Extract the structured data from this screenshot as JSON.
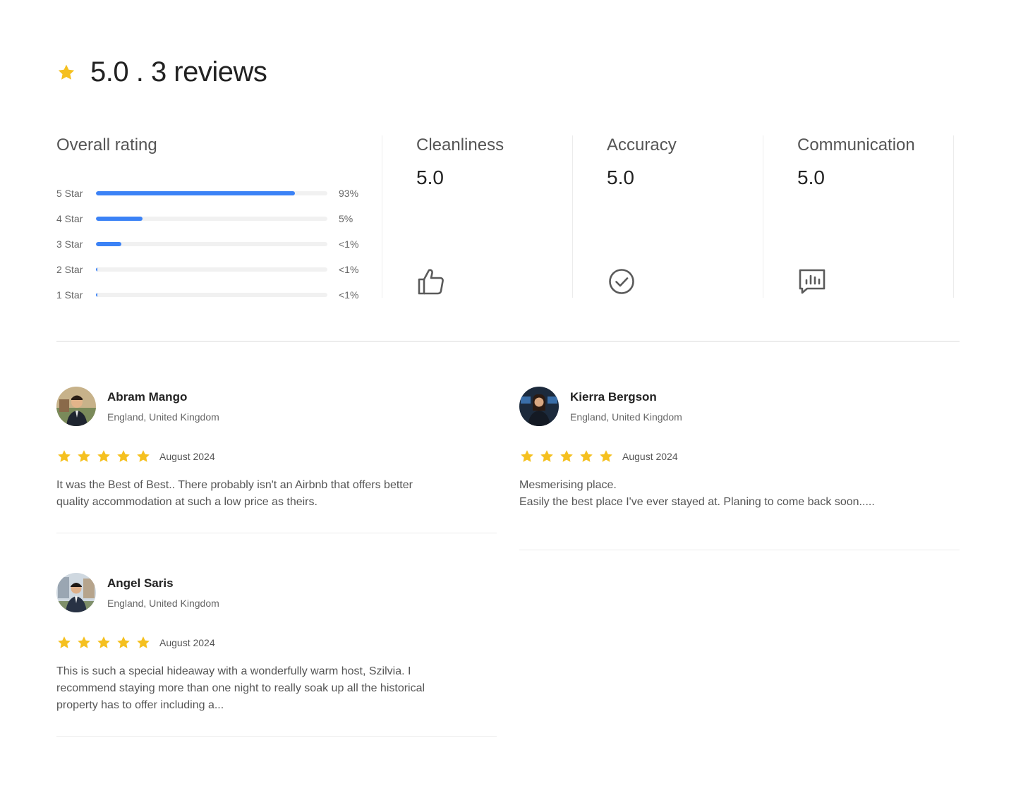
{
  "summary": {
    "title": "5.0 . 3 reviews"
  },
  "overall": {
    "heading": "Overall rating",
    "bars": [
      {
        "label": "5 Star",
        "percent_text": "93%",
        "fill_fraction": 0.86
      },
      {
        "label": "4 Star",
        "percent_text": "5%",
        "fill_fraction": 0.2
      },
      {
        "label": "3 Star",
        "percent_text": "<1%",
        "fill_fraction": 0.11
      },
      {
        "label": "2 Star",
        "percent_text": "<1%",
        "fill_fraction": 0.005
      },
      {
        "label": "1 Star",
        "percent_text": "<1%",
        "fill_fraction": 0.005
      }
    ]
  },
  "categories": [
    {
      "name": "Cleanliness",
      "value": "5.0",
      "icon": "thumbs-up-icon"
    },
    {
      "name": "Accuracy",
      "value": "5.0",
      "icon": "check-circle-icon"
    },
    {
      "name": "Communication",
      "value": "5.0",
      "icon": "chat-chart-icon"
    }
  ],
  "reviews": [
    {
      "name": "Abram Mango",
      "location": "England, United Kingdom",
      "date": "August 2024",
      "text": "It was the Best of Best.. There probably isn't an Airbnb that offers better quality accommodation at such a low price as theirs."
    },
    {
      "name": "Kierra Bergson",
      "location": "England, United Kingdom",
      "date": "August 2024",
      "text": "Mesmerising place.\nEasily the best place I've ever stayed at. Planing to come back soon....."
    },
    {
      "name": "Angel Saris",
      "location": "England, United Kingdom",
      "date": "August 2024",
      "text": "This is such a special hideaway with a wonderfully warm host, Szilvia. I recommend staying more than one night to really soak up all the historical property has to offer including a..."
    }
  ],
  "colors": {
    "star": "#F5C01F",
    "bar": "#3B82F6",
    "divider": "#ECECEC"
  }
}
